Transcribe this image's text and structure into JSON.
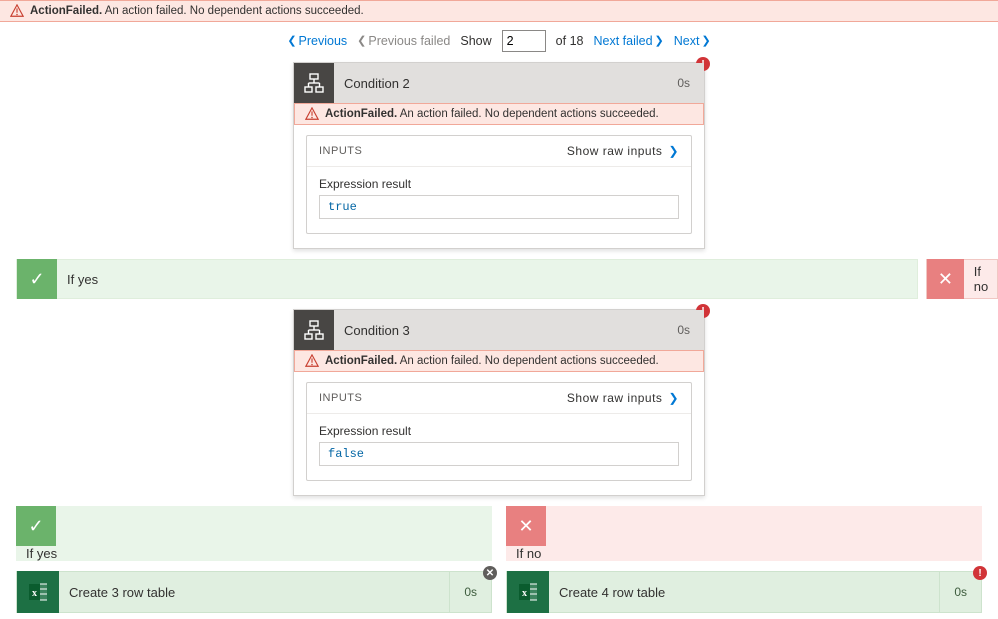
{
  "top_error": {
    "title": "ActionFailed.",
    "msg": "An action failed. No dependent actions succeeded."
  },
  "pager": {
    "previous": "Previous",
    "previous_failed": "Previous failed",
    "show": "Show",
    "current": "2",
    "of_total": "of 18",
    "next_failed": "Next failed",
    "next": "Next"
  },
  "cond2": {
    "title": "Condition 2",
    "duration": "0s",
    "error_title": "ActionFailed.",
    "error_msg": "An action failed. No dependent actions succeeded.",
    "inputs_label": "INPUTS",
    "show_raw": "Show raw inputs",
    "expr_label": "Expression result",
    "expr_value": "true"
  },
  "branch1": {
    "yes": "If yes",
    "no": "If no"
  },
  "cond3": {
    "title": "Condition 3",
    "duration": "0s",
    "error_title": "ActionFailed.",
    "error_msg": "An action failed. No dependent actions succeeded.",
    "inputs_label": "INPUTS",
    "show_raw": "Show raw inputs",
    "expr_label": "Expression result",
    "expr_value": "false"
  },
  "branch2": {
    "yes": "If yes",
    "no": "If no"
  },
  "excel_left": {
    "title": "Create 3 row table",
    "duration": "0s"
  },
  "excel_right": {
    "title": "Create 4 row table",
    "duration": "0s"
  }
}
